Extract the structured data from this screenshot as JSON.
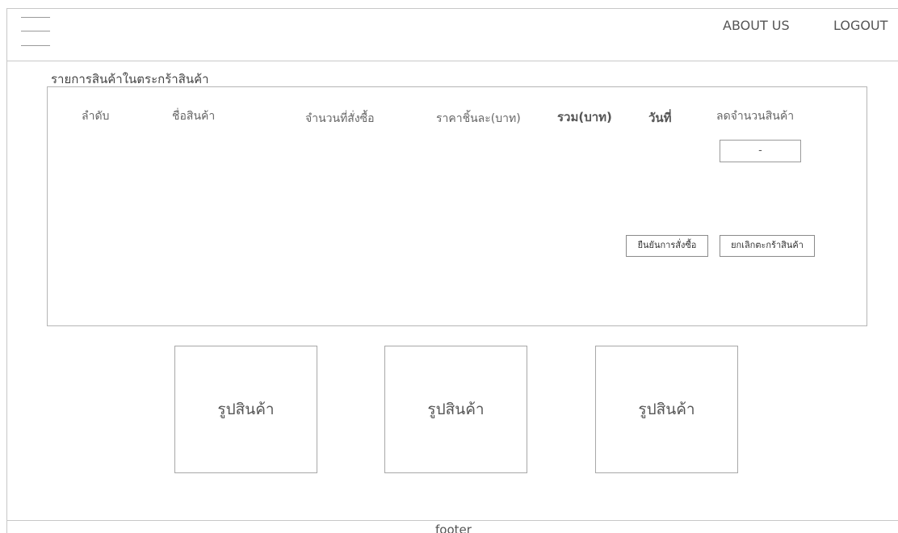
{
  "header": {
    "menu_icon": "hamburger-icon",
    "nav": {
      "about": "ABOUT US",
      "logout": "LOGOUT"
    }
  },
  "cart": {
    "title": "รายการสินค้าในตระกร้าสินค้า",
    "columns": {
      "index": "ลำดับ",
      "name": "ชื่อสินค้า",
      "quantity": "จำนวนที่สั่งซื้อ",
      "unit_price": "ราคาชิ้นละ(บาท)",
      "total": "รวม(บาท)",
      "date": "วันที่",
      "reduce": "ลดจำนวนสินค้า"
    },
    "reduce_control": "-",
    "buttons": {
      "confirm": "ยืนยันการสั่งซื้อ",
      "cancel": "ยกเลิกตะกร้าสินค้า"
    }
  },
  "products": [
    {
      "label": "รูปสินค้า"
    },
    {
      "label": "รูปสินค้า"
    },
    {
      "label": "รูปสินค้า"
    }
  ],
  "footer": {
    "label": "footer"
  }
}
